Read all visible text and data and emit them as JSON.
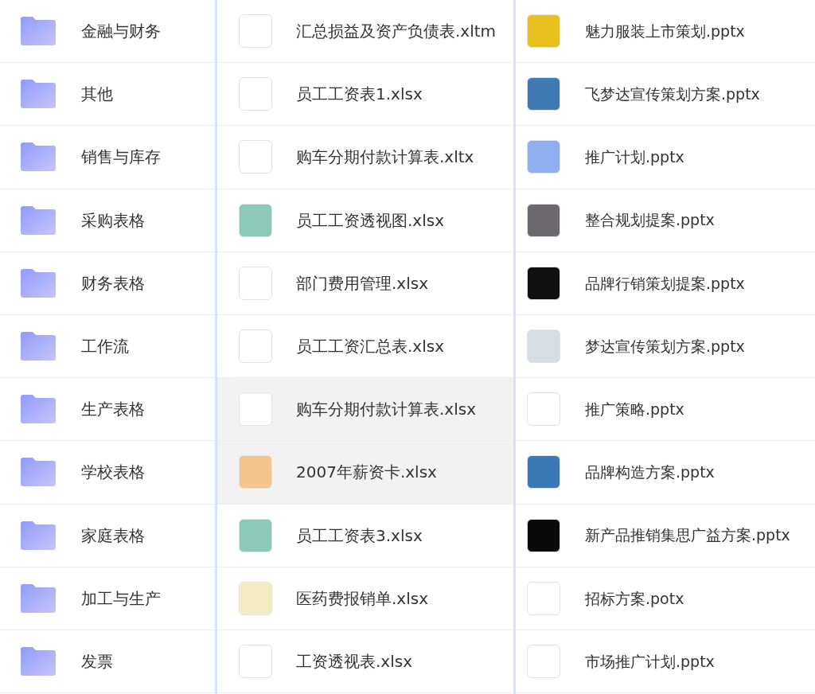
{
  "folders": [
    {
      "name": "金融与财务"
    },
    {
      "name": "其他"
    },
    {
      "name": "销售与库存"
    },
    {
      "name": "采购表格"
    },
    {
      "name": "财务表格"
    },
    {
      "name": "工作流"
    },
    {
      "name": "生产表格"
    },
    {
      "name": "学校表格"
    },
    {
      "name": "家庭表格"
    },
    {
      "name": "加工与生产"
    },
    {
      "name": "发票"
    }
  ],
  "spreadsheets": [
    {
      "name": "汇总损益及资产负债表.xltm",
      "selected": false,
      "color": "#ffffff"
    },
    {
      "name": "员工工资表1.xlsx",
      "selected": false,
      "color": "#ffffff"
    },
    {
      "name": "购车分期付款计算表.xltx",
      "selected": false,
      "color": "#ffffff"
    },
    {
      "name": "员工工资透视图.xlsx",
      "selected": false,
      "color": "#8cc9b8"
    },
    {
      "name": "部门费用管理.xlsx",
      "selected": false,
      "color": "#ffffff"
    },
    {
      "name": "员工工资汇总表.xlsx",
      "selected": false,
      "color": "#ffffff"
    },
    {
      "name": "购车分期付款计算表.xlsx",
      "selected": true,
      "color": "#ffffff"
    },
    {
      "name": "2007年薪资卡.xlsx",
      "selected": true,
      "color": "#f3c58a"
    },
    {
      "name": "员工工资表3.xlsx",
      "selected": false,
      "color": "#8cc9b8"
    },
    {
      "name": "医药费报销单.xlsx",
      "selected": false,
      "color": "#f2ecc0"
    },
    {
      "name": "工资透视表.xlsx",
      "selected": false,
      "color": "#ffffff"
    }
  ],
  "presentations": [
    {
      "name": "魅力服装上市策划.pptx",
      "color": "#e8c020"
    },
    {
      "name": "飞梦达宣传策划方案.pptx",
      "color": "#3f7ab5"
    },
    {
      "name": "推广计划.pptx",
      "color": "#8fb0f0"
    },
    {
      "name": "整合规划提案.pptx",
      "color": "#6c6a6e"
    },
    {
      "name": "品牌行销策划提案.pptx",
      "color": "#111111"
    },
    {
      "name": "梦达宣传策划方案.pptx",
      "color": "#d8dde4"
    },
    {
      "name": "推广策略.pptx",
      "color": "#ffffff"
    },
    {
      "name": "品牌构造方案.pptx",
      "color": "#3a78b8"
    },
    {
      "name": "新产品推销集思广益方案.pptx",
      "color": "#0a0a0a"
    },
    {
      "name": "招标方案.potx",
      "color": "#ffffff"
    },
    {
      "name": "市场推广计划.pptx",
      "color": "#ffffff"
    }
  ]
}
